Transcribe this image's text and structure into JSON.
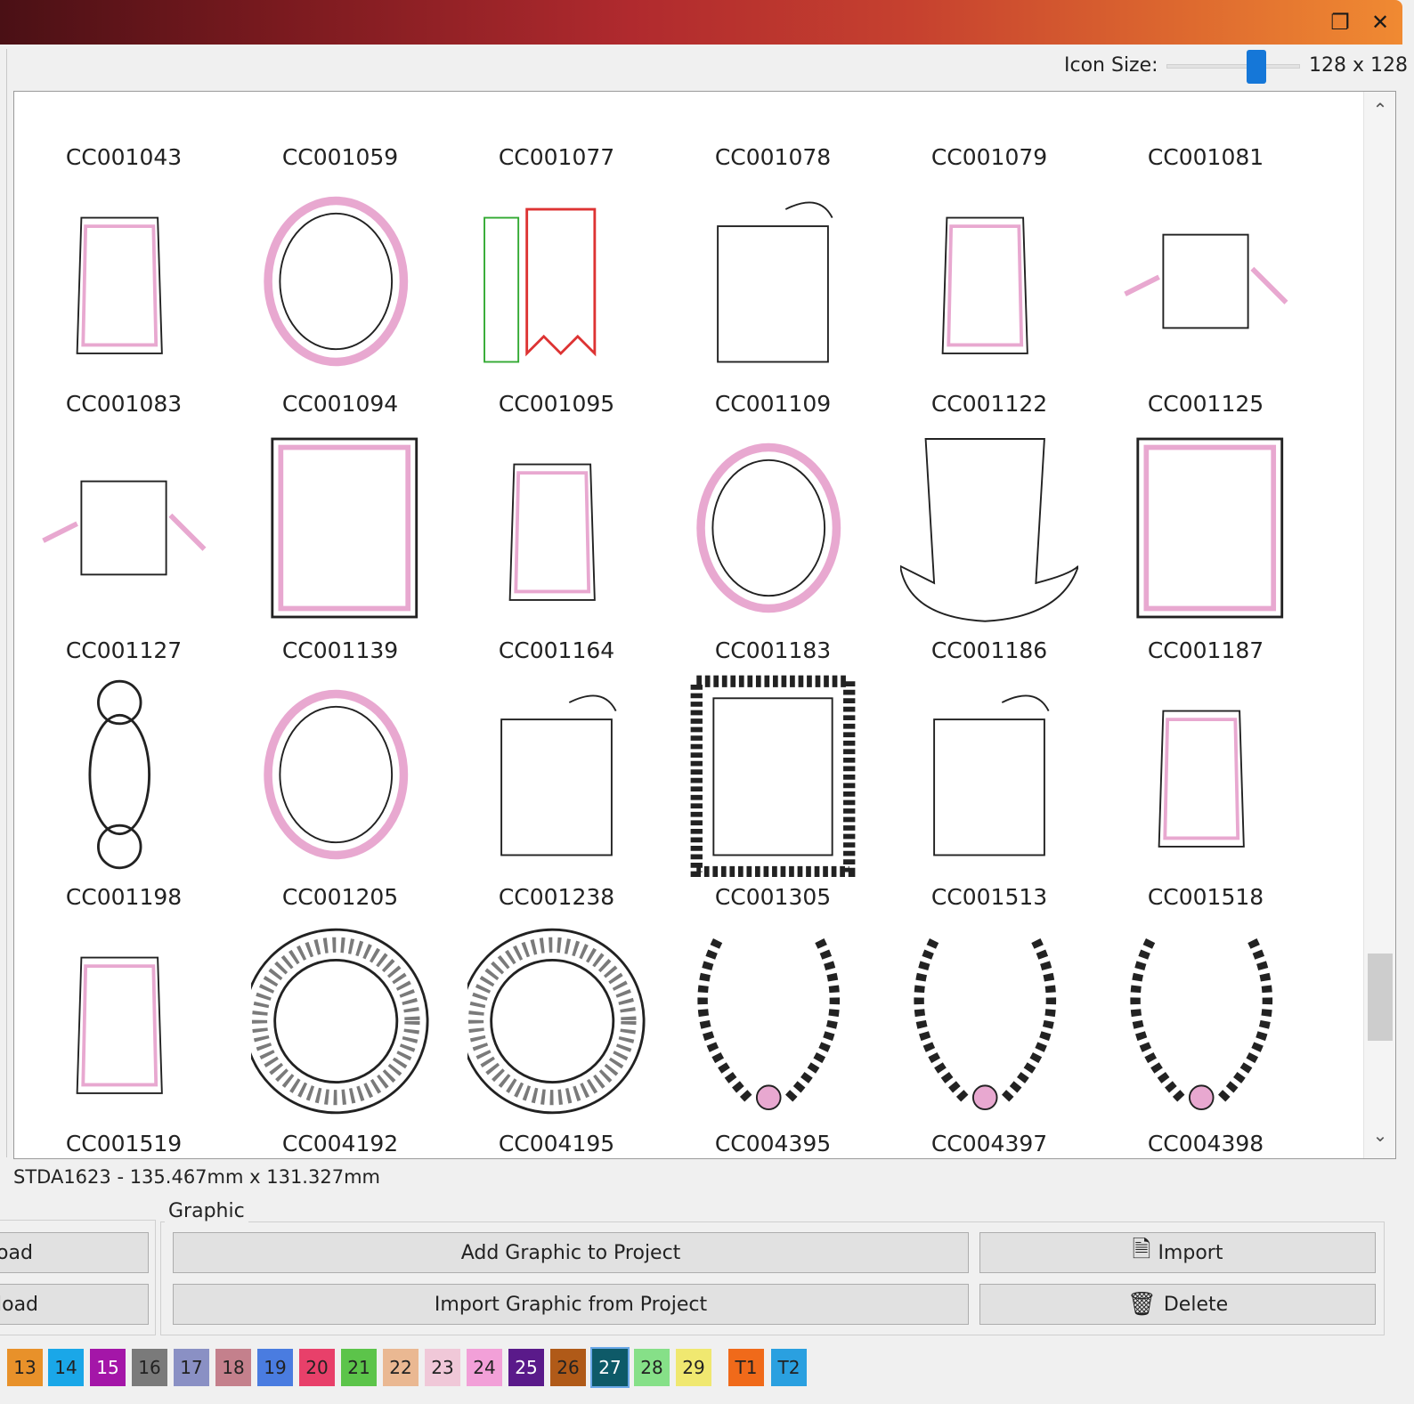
{
  "window": {
    "restore_icon": "restore-icon",
    "close_icon": "close-icon"
  },
  "toolbar": {
    "icon_size_label": "Icon Size:",
    "icon_size_value": "128 x 128",
    "icon_size_level": 0.7
  },
  "gallery": {
    "items": [
      {
        "label": "CC001043",
        "row": 0,
        "col": 0,
        "shape": "rect-top"
      },
      {
        "label": "CC001059",
        "row": 0,
        "col": 1,
        "shape": "rect-top"
      },
      {
        "label": "CC001077",
        "row": 0,
        "col": 2,
        "shape": "rect-top"
      },
      {
        "label": "CC001078",
        "row": 0,
        "col": 3,
        "shape": "rect-top"
      },
      {
        "label": "CC001079",
        "row": 0,
        "col": 4,
        "shape": "rect-top"
      },
      {
        "label": "CC001081",
        "row": 0,
        "col": 5,
        "shape": "rect-top"
      },
      {
        "label": "CC001083",
        "row": 1,
        "col": 0,
        "shape": "portrait-frame"
      },
      {
        "label": "CC001094",
        "row": 1,
        "col": 1,
        "shape": "oval-frame"
      },
      {
        "label": "CC001095",
        "row": 1,
        "col": 2,
        "shape": "banner"
      },
      {
        "label": "CC001109",
        "row": 1,
        "col": 3,
        "shape": "sign"
      },
      {
        "label": "CC001122",
        "row": 1,
        "col": 4,
        "shape": "portrait-frame"
      },
      {
        "label": "CC001125",
        "row": 1,
        "col": 5,
        "shape": "landscape-frame"
      },
      {
        "label": "CC001127",
        "row": 2,
        "col": 0,
        "shape": "landscape-frame"
      },
      {
        "label": "CC001139",
        "row": 2,
        "col": 1,
        "shape": "square-frame"
      },
      {
        "label": "CC001164",
        "row": 2,
        "col": 2,
        "shape": "portrait-frame"
      },
      {
        "label": "CC001183",
        "row": 2,
        "col": 3,
        "shape": "oval-frame"
      },
      {
        "label": "CC001186",
        "row": 2,
        "col": 4,
        "shape": "hat"
      },
      {
        "label": "CC001187",
        "row": 2,
        "col": 5,
        "shape": "square-frame"
      },
      {
        "label": "CC001198",
        "row": 3,
        "col": 0,
        "shape": "tall-oval"
      },
      {
        "label": "CC001205",
        "row": 3,
        "col": 1,
        "shape": "oval-frame"
      },
      {
        "label": "CC001238",
        "row": 3,
        "col": 2,
        "shape": "sign"
      },
      {
        "label": "CC001305",
        "row": 3,
        "col": 3,
        "shape": "ornate-rect"
      },
      {
        "label": "CC001513",
        "row": 3,
        "col": 4,
        "shape": "sign"
      },
      {
        "label": "CC001518",
        "row": 3,
        "col": 5,
        "shape": "portrait-frame"
      },
      {
        "label": "CC001519",
        "row": 4,
        "col": 0,
        "shape": "portrait-frame"
      },
      {
        "label": "CC004192",
        "row": 4,
        "col": 1,
        "shape": "ring"
      },
      {
        "label": "CC004195",
        "row": 4,
        "col": 2,
        "shape": "ring"
      },
      {
        "label": "CC004395",
        "row": 4,
        "col": 3,
        "shape": "wreath"
      },
      {
        "label": "CC004397",
        "row": 4,
        "col": 4,
        "shape": "wreath"
      },
      {
        "label": "CC004398",
        "row": 4,
        "col": 5,
        "shape": "wreath"
      }
    ]
  },
  "status": {
    "text": "STDA1623 - 135.467mm x 131.327mm"
  },
  "buttons": {
    "upload_label": "oad",
    "download_label": "load",
    "graphic_group_title": "Graphic",
    "add_graphic_label": "Add Graphic to Project",
    "import_from_project_label": "Import Graphic from Project",
    "import_label": "Import",
    "delete_label": "Delete",
    "import_icon": "import-icon",
    "delete_icon": "trash-icon"
  },
  "color_tabs": [
    {
      "label": "13",
      "color": "#e8912a"
    },
    {
      "label": "14",
      "color": "#1aa7e8"
    },
    {
      "label": "15",
      "color": "#a416a8"
    },
    {
      "label": "16",
      "color": "#7a7a7a"
    },
    {
      "label": "17",
      "color": "#8a90c4"
    },
    {
      "label": "18",
      "color": "#c4808c"
    },
    {
      "label": "19",
      "color": "#4a7ce0"
    },
    {
      "label": "20",
      "color": "#e8406a"
    },
    {
      "label": "21",
      "color": "#5cc44a"
    },
    {
      "label": "22",
      "color": "#eab892"
    },
    {
      "label": "23",
      "color": "#f0c8d8"
    },
    {
      "label": "24",
      "color": "#f2a0d8"
    },
    {
      "label": "25",
      "color": "#5a1a8a"
    },
    {
      "label": "26",
      "color": "#b05a18"
    },
    {
      "label": "27",
      "color": "#0e5a68"
    },
    {
      "label": "28",
      "color": "#86e088"
    },
    {
      "label": "29",
      "color": "#f0e870"
    },
    {
      "label": "T1",
      "color": "#f06a1a"
    },
    {
      "label": "T2",
      "color": "#2aa0e0"
    }
  ]
}
